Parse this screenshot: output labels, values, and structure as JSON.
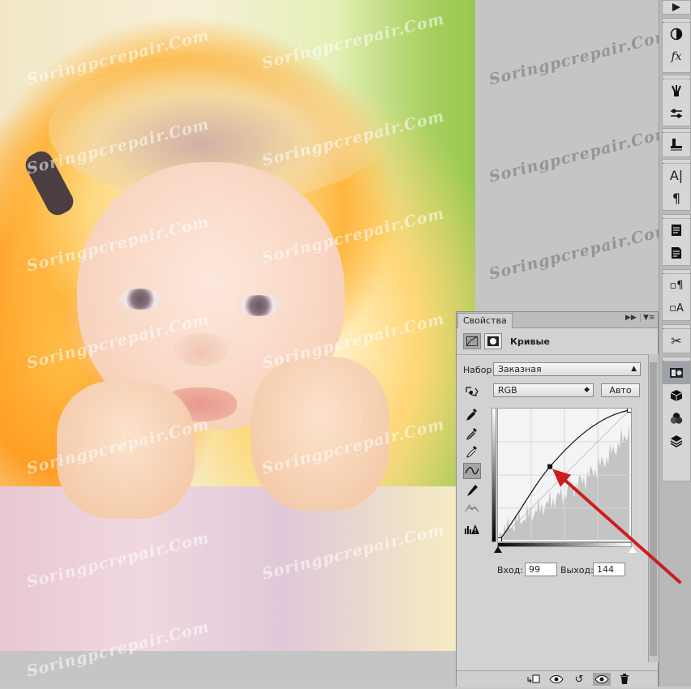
{
  "watermark": "Soringpcrepair.Com",
  "panel": {
    "tab_title": "Свойства",
    "header_label": "Кривые",
    "preset_label": "Набор:",
    "preset_value": "Заказная",
    "channel_value": "RGB",
    "auto_label": "Авто",
    "input_label": "Вход:",
    "input_value": "99",
    "output_label": "Выход:",
    "output_value": "144"
  },
  "curve": {
    "control_point": {
      "input": 99,
      "output": 144
    },
    "range": [
      0,
      255
    ]
  },
  "colors": {
    "annotation_arrow": "#cc1e1e",
    "panel_bg": "#d2d2d2",
    "strip_bg": "#b9b9b9",
    "histogram": "#c4c4c4"
  },
  "right_strip": {
    "icons": [
      "play-icon",
      "adjustments-icon",
      "fx-icon",
      "brush-presets-icon",
      "clone-source-icon",
      "tool-presets-icon",
      "character-icon",
      "paragraph-icon",
      "character-styles-icon",
      "paragraph-styles-icon",
      "glyph-styles-icon",
      "glyph-a-icon",
      "measurement-icon",
      "properties-icon",
      "3d-icon",
      "channels-icon",
      "layers-icon"
    ]
  }
}
